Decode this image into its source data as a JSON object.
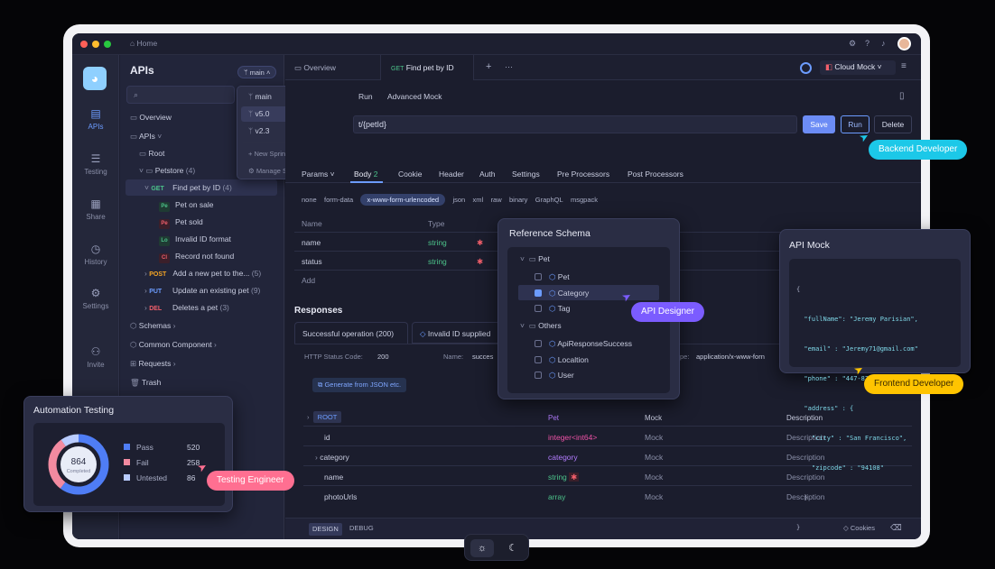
{
  "titlebar": {
    "home": "Home"
  },
  "rail": {
    "apis": "APIs",
    "testing": "Testing",
    "share": "Share",
    "history": "History",
    "settings": "Settings",
    "invite": "Invite"
  },
  "sidebar": {
    "title": "APIs",
    "branch": "main",
    "overview": "Overview",
    "apis": "APIs",
    "root": "Root",
    "petstore": "Petstore",
    "petstore_count": "(4)",
    "find": {
      "method": "GET",
      "label": "Find pet by ID",
      "count": "(4)"
    },
    "cases": [
      {
        "tag": "Pe",
        "label": "Pet on sale",
        "color": "#4cc38a"
      },
      {
        "tag": "Pe",
        "label": "Pet sold",
        "color": "#f25f6b"
      },
      {
        "tag": "Lo",
        "label": "Invalid ID format",
        "color": "#4cc38a"
      },
      {
        "tag": "Cl",
        "label": "Record not found",
        "color": "#f25f6b"
      }
    ],
    "post": {
      "method": "POST",
      "label": "Add a new pet to the...",
      "count": "(5)"
    },
    "put": {
      "method": "PUT",
      "label": "Update an existing pet",
      "count": "(9)"
    },
    "del": {
      "method": "DEL",
      "label": "Deletes a pet",
      "count": "(3)"
    },
    "schemas": "Schemas",
    "common": "Common Component",
    "requests": "Requests",
    "trash": "Trash"
  },
  "branch_menu": {
    "items": [
      "main",
      "v5.0",
      "v2.3"
    ],
    "new": "New Sprint Branch",
    "manage": "Manage Sprint Branches"
  },
  "tabs": {
    "overview": "Overview",
    "method": "GET",
    "active": "Find pet by ID",
    "plus": "+",
    "more": "···",
    "env": "Cloud Mock"
  },
  "subtabs": {
    "run": "Run",
    "advanced": "Advanced Mock"
  },
  "url": {
    "path": "t/{petId}",
    "save": "Save",
    "run": "Run",
    "delete": "Delete"
  },
  "req_tabs": {
    "params": "Params",
    "body": "Body",
    "body_count": "2",
    "cookie": "Cookie",
    "header": "Header",
    "auth": "Auth",
    "settings": "Settings",
    "pre": "Pre Processors",
    "post": "Post Processors"
  },
  "body_types": [
    "none",
    "form-data",
    "x-www-form-urlencoded",
    "json",
    "xml",
    "raw",
    "binary",
    "GraphQL",
    "msgpack"
  ],
  "params_table": {
    "col_name": "Name",
    "col_type": "Type",
    "rows": [
      {
        "name": "name",
        "type": "string"
      },
      {
        "name": "status",
        "type": "string"
      }
    ],
    "add": "Add"
  },
  "responses": {
    "title": "Responses",
    "tab1": "Successful operation (200)",
    "tab2": "Invalid ID supplied",
    "status_label": "HTTP Status Code:",
    "status": "200",
    "name_label": "Name:",
    "name": "succes",
    "ct_label": "pe:",
    "ct": "application/x-www-forn",
    "gen": "Generate from JSON etc.",
    "cols": {
      "pet": "Pet",
      "mock": "Mock",
      "desc": "Description"
    },
    "rows": [
      {
        "name": "ROOT",
        "type": "Pet",
        "mock": "",
        "desc": ""
      },
      {
        "name": "id",
        "type": "integer<int64>",
        "mock": "Mock",
        "desc": "Description"
      },
      {
        "name": "category",
        "type": "category",
        "mock": "Mock",
        "desc": "Description"
      },
      {
        "name": "name",
        "type": "string",
        "mock": "Mock",
        "desc": "Description"
      },
      {
        "name": "photoUrls",
        "type": "array",
        "mock": "Mock",
        "desc": "Description"
      }
    ]
  },
  "bottom": {
    "design": "DESIGN",
    "debug": "DEBUG",
    "cookies": "Cookies"
  },
  "ref_schema": {
    "title": "Reference Schema",
    "pet": "Pet",
    "items": [
      "Pet",
      "Category",
      "Tag"
    ],
    "others": "Others",
    "others_items": [
      "ApiResponseSuccess",
      "Localtion",
      "User"
    ]
  },
  "api_mock": {
    "title": "API Mock",
    "lines": [
      "{",
      "  \"fullName\": \"Jeremy Parisian\",",
      "  \"email\" : \"Jeremy71@gmail.com\"",
      "  \"phone\" : \"447-825-8179\",",
      "  \"address\" : {",
      "    \"city\" : \"San Francisco\",",
      "    \"zipcode\" : \"94108\"",
      "  }",
      "}"
    ]
  },
  "automation": {
    "title": "Automation Testing",
    "total": "864",
    "completed": "Completed",
    "legend": [
      {
        "label": "Pass",
        "value": "520",
        "color": "#4f7df5"
      },
      {
        "label": "Fail",
        "value": "258",
        "color": "#f28aa0"
      },
      {
        "label": "Untested",
        "value": "86",
        "color": "#b9ccff"
      }
    ]
  },
  "chart_data": {
    "type": "pie",
    "labels": [
      "Pass",
      "Fail",
      "Untested"
    ],
    "values": [
      520,
      258,
      86
    ],
    "total": 864
  },
  "personas": {
    "backend": "Backend Developer",
    "designer": "API Designer",
    "frontend": "Frontend Developer",
    "tester": "Testing Engineer"
  },
  "colors": {
    "accent": "#6c9cff",
    "cyan": "#1cc8e8",
    "purple": "#7b5cff",
    "yellow": "#ffc400",
    "pink": "#ff6f91"
  }
}
